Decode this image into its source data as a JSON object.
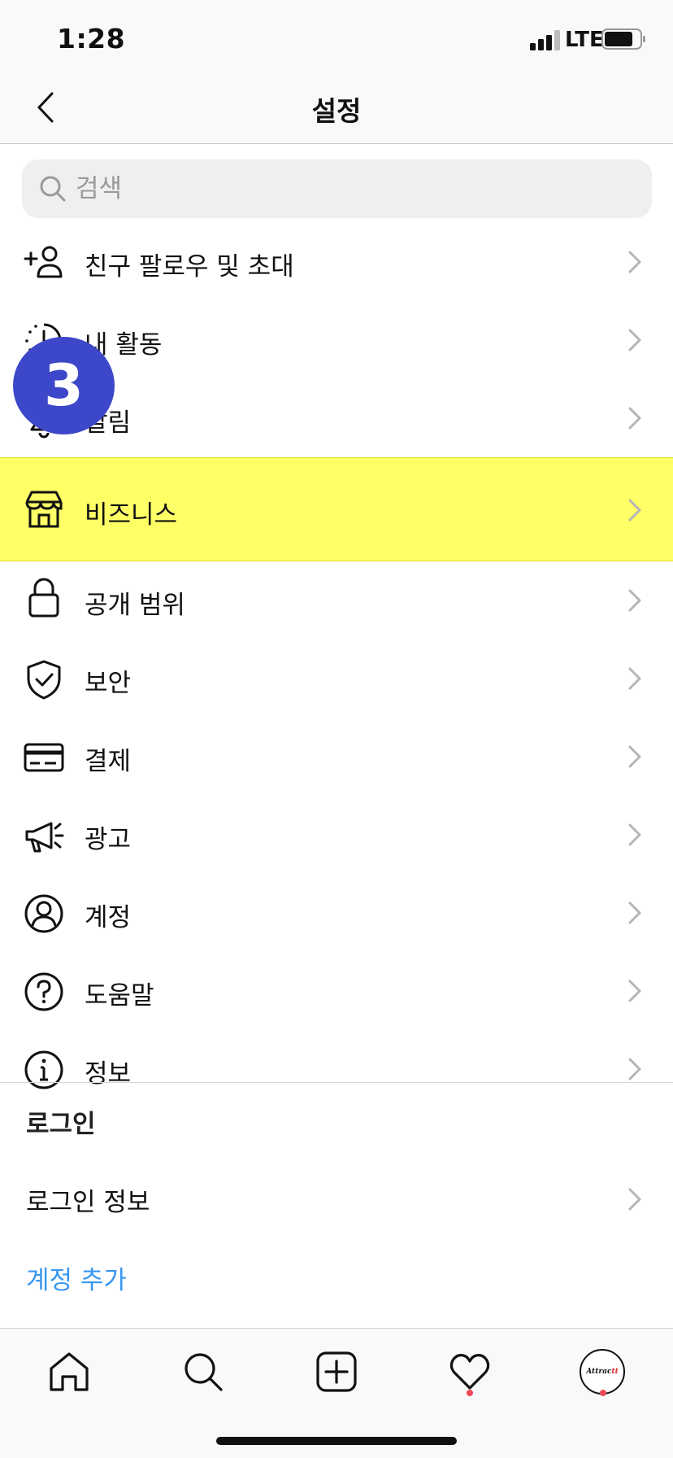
{
  "status_bar": {
    "time": "1:28",
    "network": "LTE"
  },
  "header": {
    "title": "설정"
  },
  "search": {
    "placeholder": "검색"
  },
  "menu": {
    "items": [
      {
        "label": "친구 팔로우 및 초대",
        "icon": "add-person-icon"
      },
      {
        "label": "내 활동",
        "icon": "activity-icon"
      },
      {
        "label": "알림",
        "icon": "bell-icon"
      },
      {
        "label": "비즈니스",
        "icon": "shop-icon"
      },
      {
        "label": "공개 범위",
        "icon": "lock-icon"
      },
      {
        "label": "보안",
        "icon": "shield-check-icon"
      },
      {
        "label": "결제",
        "icon": "card-icon"
      },
      {
        "label": "광고",
        "icon": "megaphone-icon"
      },
      {
        "label": "계정",
        "icon": "account-icon"
      },
      {
        "label": "도움말",
        "icon": "help-icon"
      },
      {
        "label": "정보",
        "icon": "info-icon"
      }
    ],
    "highlighted_index": 3,
    "highlight_color": "#ffff66"
  },
  "login": {
    "section_title": "로그인",
    "info_label": "로그인 정보",
    "add_account_label": "계정 추가"
  },
  "step_badge": {
    "number": "3",
    "color": "#3d47c9"
  },
  "tab_bar": {
    "tabs": [
      "home-icon",
      "search-icon",
      "new-post-icon",
      "heart-icon",
      "profile-avatar"
    ],
    "avatar_text_part1": "Attrac",
    "avatar_text_part2": "tt"
  },
  "colors": {
    "link": "#3897f0",
    "notification_dot": "#ed4956"
  }
}
